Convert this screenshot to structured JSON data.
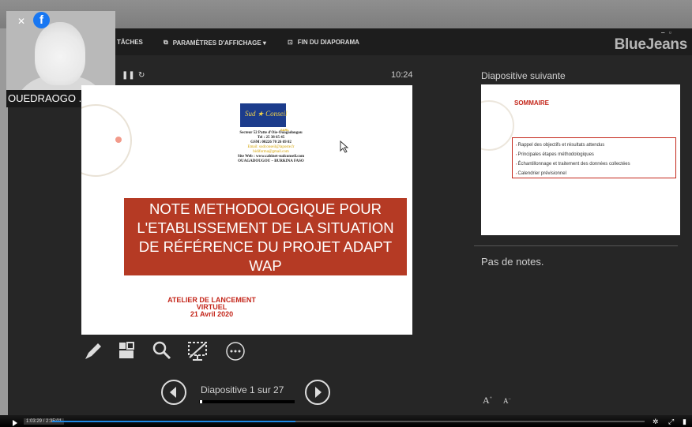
{
  "toolbar": {
    "tasks": "TÂCHES",
    "display_settings": "PARAMÈTRES D'AFFICHAGE ▾",
    "end_slideshow": "FIN DU DIAPORAMA",
    "brand": "BlueJeans"
  },
  "webcam": {
    "participant_name": "OUEDRAOGO ..."
  },
  "presenter": {
    "timer": "10:24",
    "next_slide_label": "Diapositive suivante",
    "notes": "Pas de notes.",
    "slide_counter": "Diapositive 1 sur 27",
    "font_increase": "A",
    "font_decrease": "A"
  },
  "current_slide": {
    "logo_text": "Sud ★ Conseil",
    "logo_suffix": "SARL",
    "contact_lines": [
      "Secteur 52 Patte d'Oie-Ouagadougou",
      "Tel : 25 38 65 45",
      "GSM: 00226 70 26 69 02",
      "Email: sudconseil@laposte.fr",
      "bidiforma@gmail.com",
      "Site Web : www.cabinet-sudconseil.com",
      "OUAGADOUGOU – BURKINA FASO"
    ],
    "title_lines": [
      "NOTE METHODOLOGIQUE  POUR",
      "L'ETABLISSEMENT DE LA SITUATION",
      "DE  RÉFÉRENCE DU PROJET ADAPT",
      "WAP"
    ],
    "event_lines": [
      "ATELIER DE LANCEMENT",
      "VIRTUEL",
      "21 Avril 2020"
    ]
  },
  "next_slide": {
    "title": "SOMMAIRE",
    "items": [
      "Rappel des objectifs et résultats attendus",
      "Principales étapes méthodologiques",
      "Échantillonnage et traitement des données collectées",
      "Calendrier prévisionnel"
    ]
  },
  "player": {
    "time": "1:03:29 / 2:35:01",
    "progress_fraction": 0.41
  },
  "colors": {
    "title_banner": "#b53a24",
    "accent_red": "#c4271b",
    "logo_blue": "#1c3c8c"
  }
}
